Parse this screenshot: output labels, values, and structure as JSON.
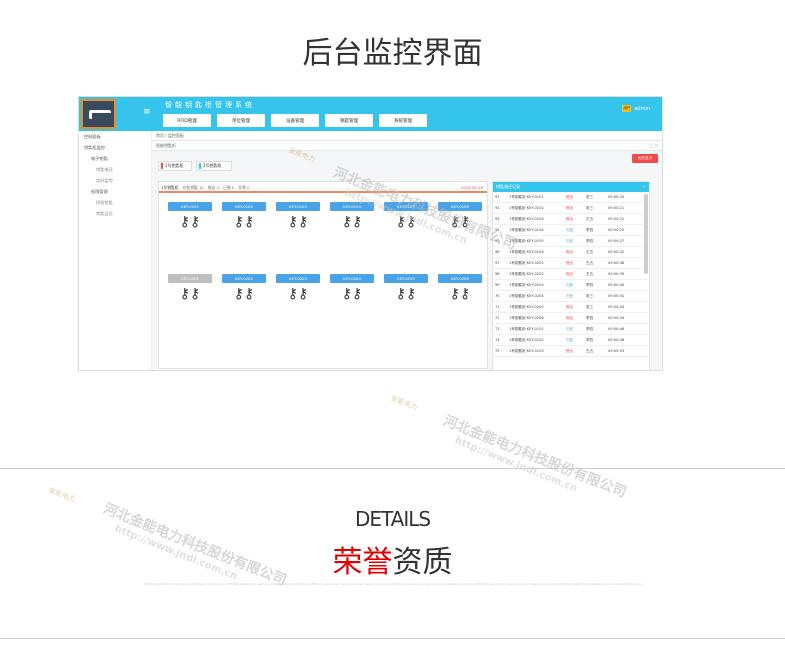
{
  "page": {
    "title": "后台监控界面",
    "details": "DETAILS",
    "honor_red": "荣誉",
    "honor_rest": "资质",
    "fine_print": "DETAILS safety tool cabinet product detail introduction DETAILS safety tool cabinet product detail introduction DETAILS safety tool cabinet product detail introduction DETAILS safety tool cabinet product detail introduction DETAILS safety tool cabinet product detail introduction DETAILS safety tool cabinet product detail introduction"
  },
  "watermark": {
    "company": "河北金能电力科技股份有限公司",
    "url": "http://www.jndl.com.cn",
    "logo": "金能电力"
  },
  "app": {
    "system_name": "智能钥匙柜管理系统",
    "menu_icon": "≡",
    "user_badge": "用户",
    "user_name": "admin",
    "nav": [
      "RFID管理",
      "单位管理",
      "设备管理",
      "钥匙管理",
      "系统管理"
    ],
    "sidebar": [
      "控制面板",
      "钥匙柜监控",
      "电子钥匙",
      "钥匙借还",
      "实时监控",
      "权限管理",
      "授权钥匙",
      "钥匙日志"
    ],
    "breadcrumb": "首页 / 监控面板",
    "tab_title": "智能钥匙柜",
    "window_icons": "□ ⊡",
    "priority_button": "优先显示",
    "cabinet_tabs": [
      "1号钥匙柜",
      "2号钥匙柜"
    ],
    "panel_tabs": [
      "1号钥匙柜",
      "在柜钥匙 12",
      "借出 3",
      "已借 0",
      "异常 0"
    ],
    "panel_date": "2019-05-29",
    "slots_row1": [
      "KEY-0101",
      "KEY-0102",
      "KEY-0103",
      "KEY-0104",
      "KEY-0105",
      "KEY-0106"
    ],
    "slots_row2": [
      "KEY-0201",
      "KEY-0202",
      "KEY-0203",
      "KEY-0204",
      "KEY-0205",
      "KEY-0206"
    ],
    "log_title": "钥匙借还记录",
    "log_minimize": "–",
    "log_rows": [
      [
        "91",
        "1号钥匙柜 KEY-0101",
        "借出",
        "张三",
        "09:00:20"
      ],
      [
        "92",
        "1号钥匙柜 KEY-0102",
        "借出",
        "张三",
        "09:00:21"
      ],
      [
        "93",
        "1号钥匙柜 KEY-0103",
        "借出",
        "王五",
        "09:00:21"
      ],
      [
        "94",
        "1号钥匙柜 KEY-0104",
        "归还",
        "李四",
        "09:00:25"
      ],
      [
        "95",
        "1号钥匙柜 KEY-0105",
        "归还",
        "李四",
        "09:00:27"
      ],
      [
        "96",
        "1号钥匙柜 KEY-0106",
        "借出",
        "王五",
        "09:00:32"
      ],
      [
        "97",
        "1号钥匙柜 KEY-0201",
        "借出",
        "王五",
        "09:00:38"
      ],
      [
        "98",
        "1号钥匙柜 KEY-0202",
        "借出",
        "王五",
        "09:00:39"
      ],
      [
        "99",
        "1号钥匙柜 KEY-0203",
        "归还",
        "李四",
        "09:00:40"
      ],
      [
        "70",
        "1号钥匙柜 KEY-0204",
        "归还",
        "张三",
        "09:00:41"
      ],
      [
        "71",
        "1号钥匙柜 KEY-0205",
        "借出",
        "张三",
        "09:00:43"
      ],
      [
        "72",
        "1号钥匙柜 KEY-0206",
        "借出",
        "李四",
        "09:00:44"
      ],
      [
        "73",
        "1号钥匙柜 KEY-0101",
        "归还",
        "李四",
        "09:00:46"
      ],
      [
        "74",
        "1号钥匙柜 KEY-0102",
        "归还",
        "李四",
        "09:00:48"
      ],
      [
        "75",
        "1号钥匙柜 KEY-0103",
        "借出",
        "王五",
        "09:00:53"
      ]
    ]
  },
  "colors": {
    "accent": "#35c4ec",
    "alert": "#f14a4a",
    "slot_active": "#4aa3e8",
    "slot_inactive": "#bfbfbf",
    "honor_red": "#e00000"
  }
}
